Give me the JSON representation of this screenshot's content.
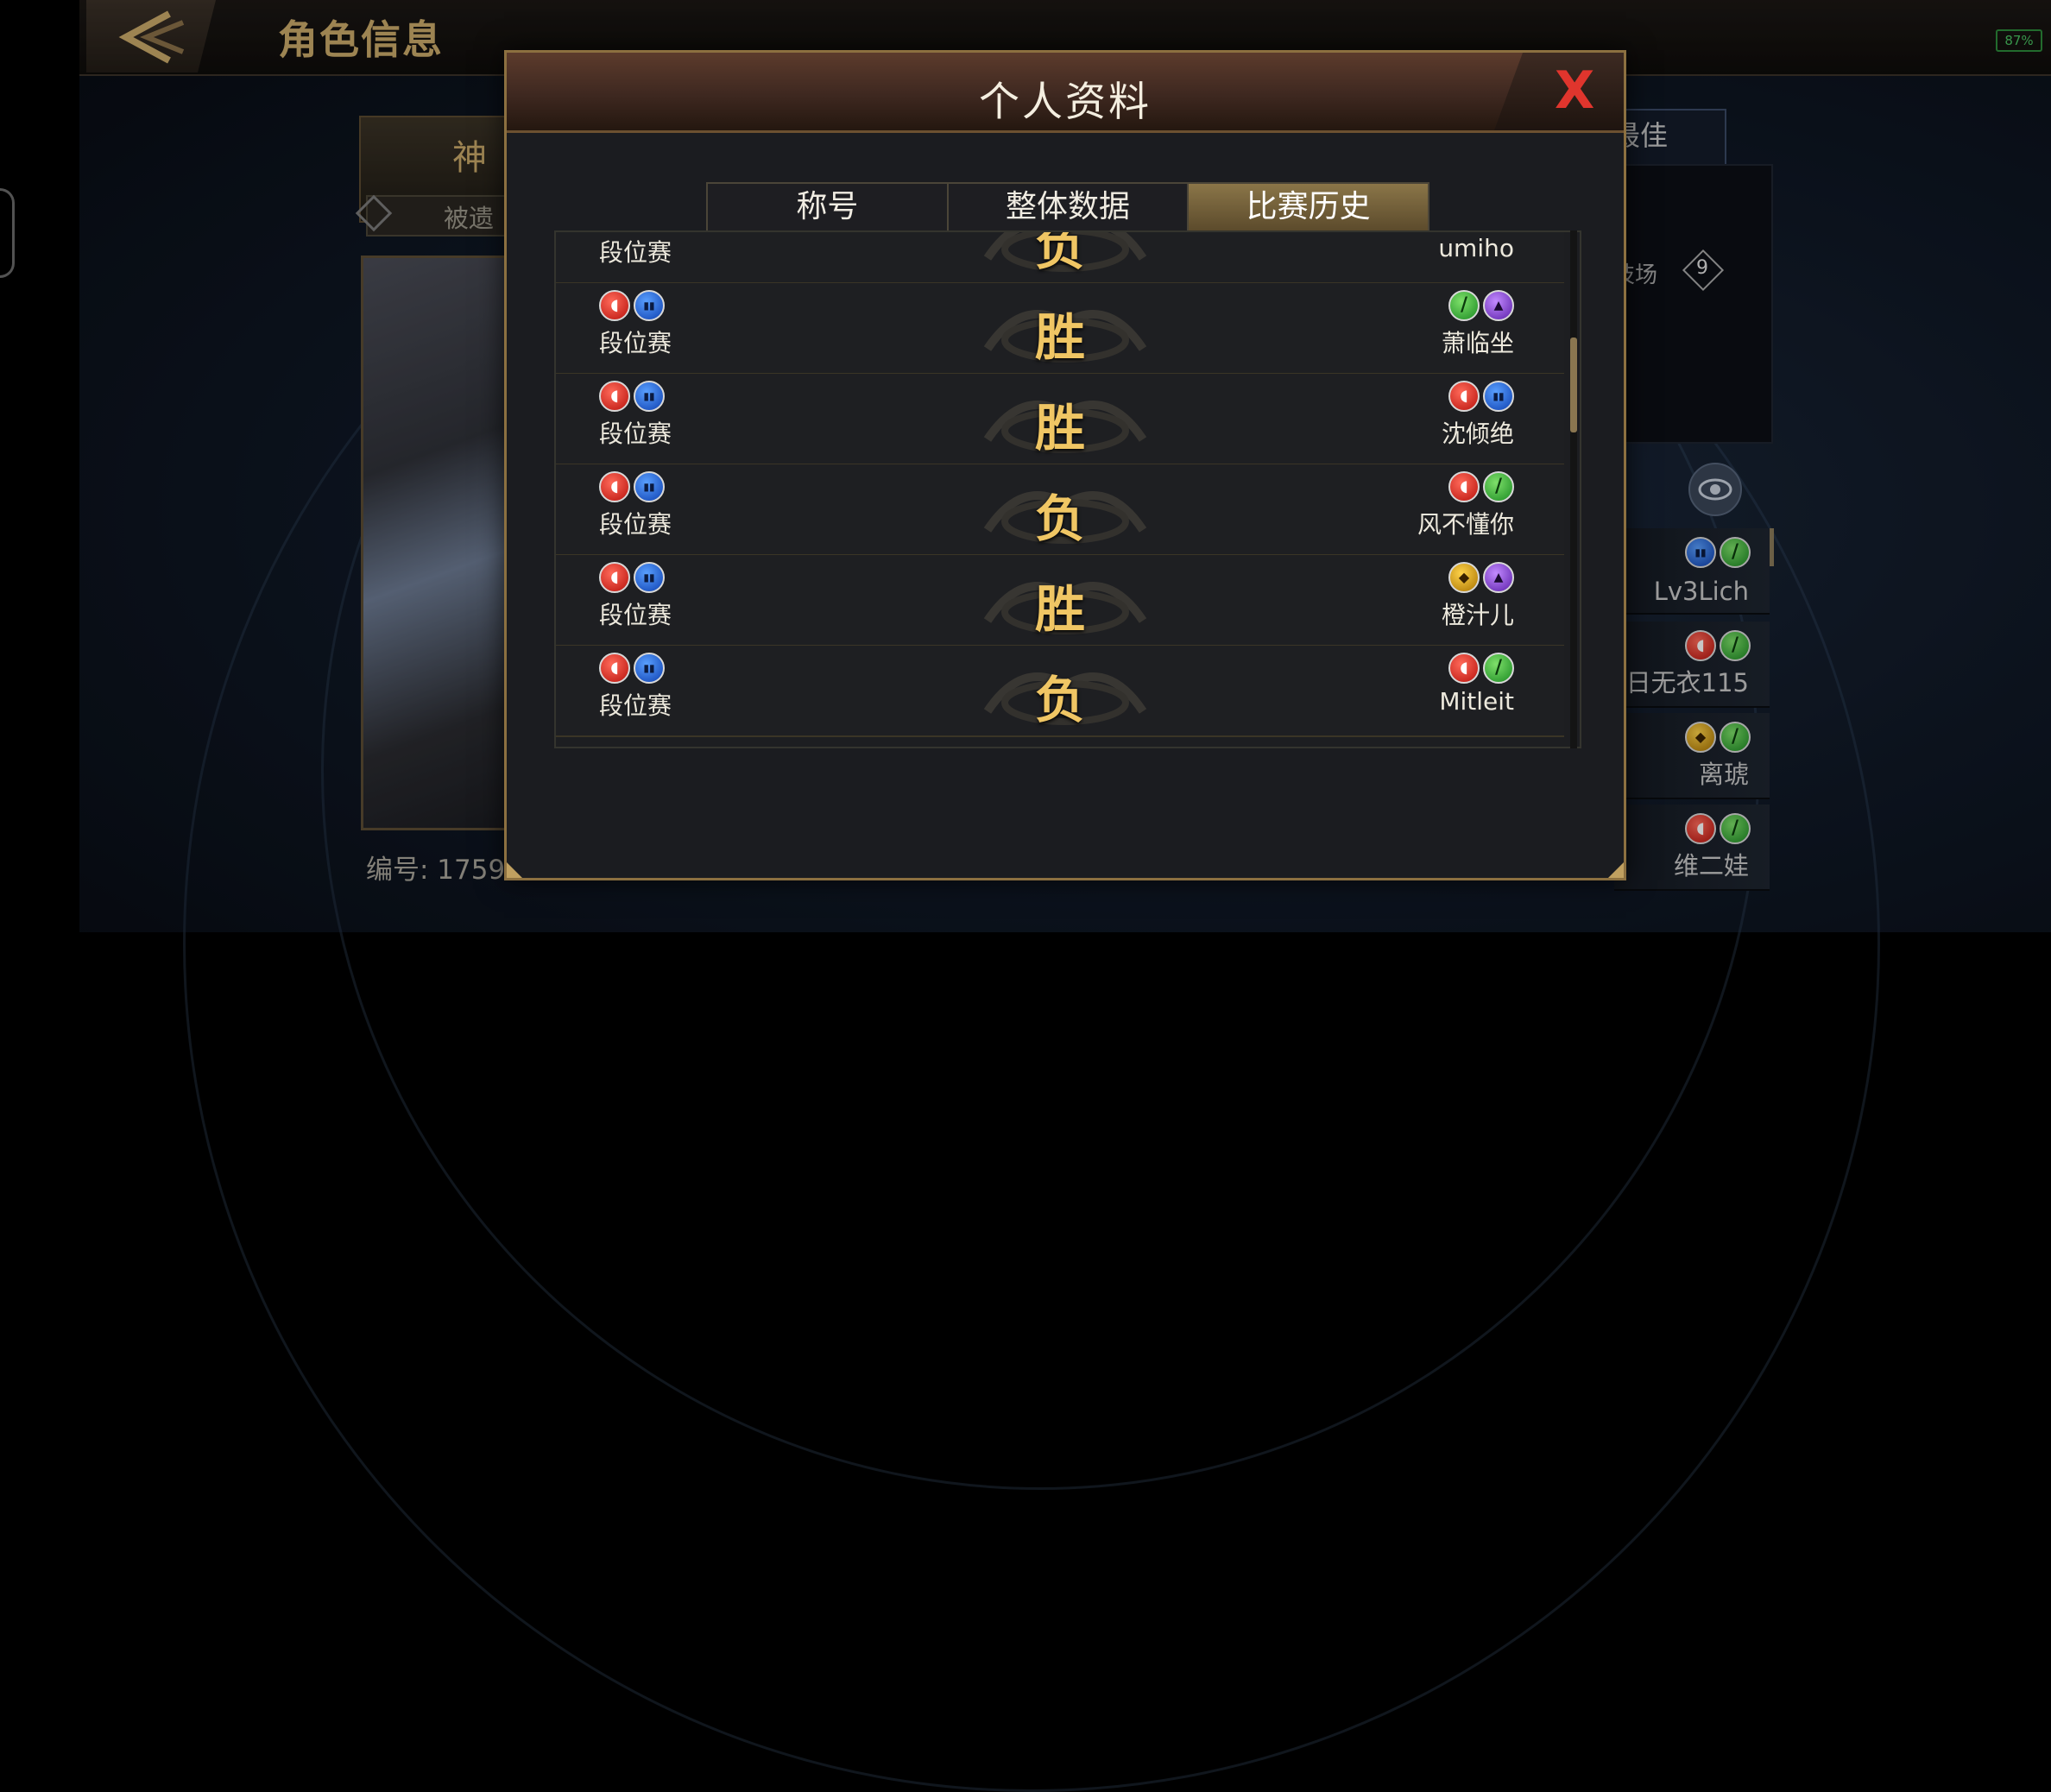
{
  "screen": {
    "title": "角色信息",
    "battery_label": "87%"
  },
  "background": {
    "left_title": "神",
    "left_subtitle": "被遗",
    "id_label": "编号: 1759",
    "right_tab": "最佳",
    "arena_label": "技场",
    "arena_badge": "9",
    "right_list": [
      {
        "name": "Lv3Lich",
        "icons": [
          "blue",
          "green"
        ]
      },
      {
        "name": "日无衣115",
        "icons": [
          "red",
          "green"
        ]
      },
      {
        "name": "离琥",
        "icons": [
          "gold",
          "green"
        ]
      },
      {
        "name": "维二娃",
        "icons": [
          "red",
          "green"
        ]
      }
    ]
  },
  "modal": {
    "title": "个人资料",
    "close_label": "X",
    "tabs": [
      {
        "label": "称号",
        "active": false
      },
      {
        "label": "整体数据",
        "active": false
      },
      {
        "label": "比赛历史",
        "active": true
      }
    ],
    "matches": [
      {
        "mode": "段位赛",
        "result": "负",
        "opponent": "umiho",
        "my_icons": [
          "red",
          "blue"
        ],
        "opponent_icons": [
          "blue",
          "green"
        ]
      },
      {
        "mode": "段位赛",
        "result": "胜",
        "opponent": "萧临坐",
        "my_icons": [
          "red",
          "blue"
        ],
        "opponent_icons": [
          "green",
          "purple"
        ]
      },
      {
        "mode": "段位赛",
        "result": "胜",
        "opponent": "沈倾绝",
        "my_icons": [
          "red",
          "blue"
        ],
        "opponent_icons": [
          "red",
          "blue"
        ]
      },
      {
        "mode": "段位赛",
        "result": "负",
        "opponent": "风不懂你",
        "my_icons": [
          "red",
          "blue"
        ],
        "opponent_icons": [
          "red",
          "green"
        ]
      },
      {
        "mode": "段位赛",
        "result": "胜",
        "opponent": "橙汁儿",
        "my_icons": [
          "red",
          "blue"
        ],
        "opponent_icons": [
          "gold",
          "purple"
        ]
      },
      {
        "mode": "段位赛",
        "result": "负",
        "opponent": "Mitleit",
        "my_icons": [
          "red",
          "blue"
        ],
        "opponent_icons": [
          "red",
          "green"
        ]
      }
    ]
  }
}
